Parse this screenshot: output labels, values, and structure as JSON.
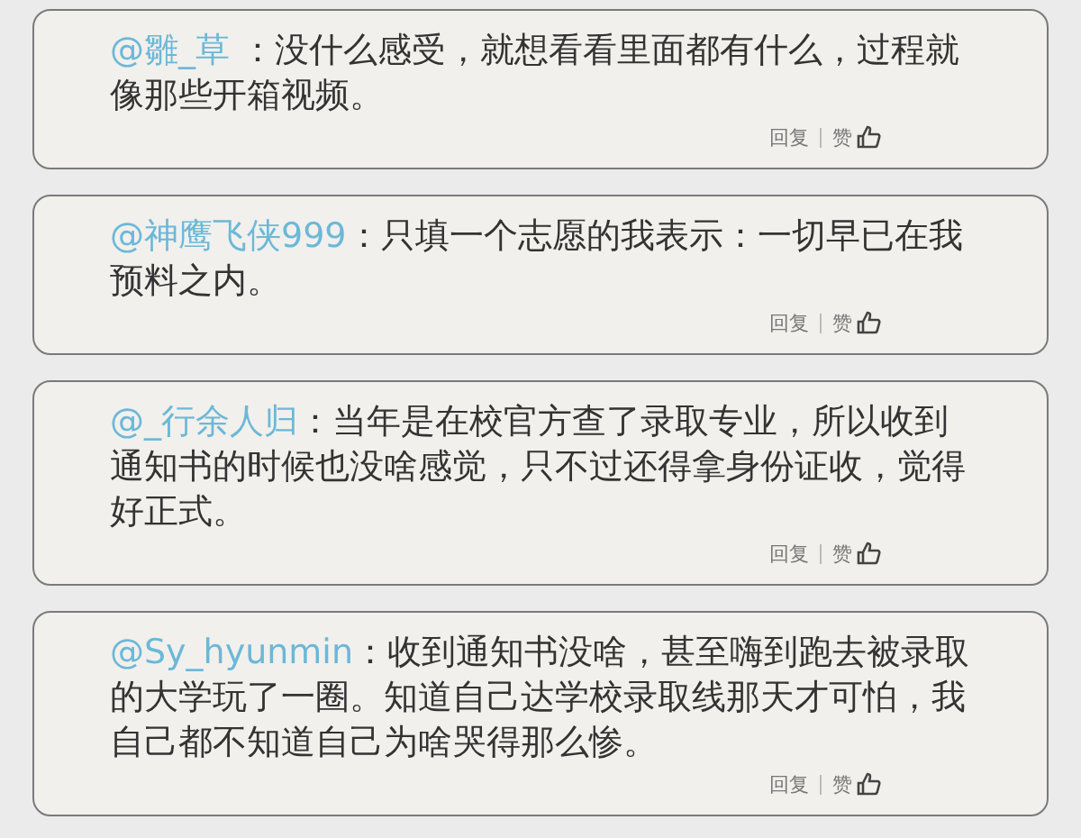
{
  "comments": [
    {
      "user": "@雛_草",
      "text": " ：没什么感受，就想看看里面都有什么，过程就像那些开箱视频。",
      "reply": "回复",
      "like": "赞"
    },
    {
      "user": "@神鹰飞侠999",
      "text": "：只填一个志愿的我表示：一切早已在我预料之内。",
      "reply": "回复",
      "like": "赞"
    },
    {
      "user": "@_行余人归",
      "text": "：当年是在校官方查了录取专业，所以收到通知书的时候也没啥感觉，只不过还得拿身份证收，觉得好正式。",
      "reply": "回复",
      "like": "赞"
    },
    {
      "user": "@Sy_hyunmin",
      "text": "：收到通知书没啥，甚至嗨到跑去被录取的大学玩了一圈。知道自己达学校录取线那天才可怕，我自己都不知道自己为啥哭得那么惨。",
      "reply": "回复",
      "like": "赞"
    }
  ]
}
